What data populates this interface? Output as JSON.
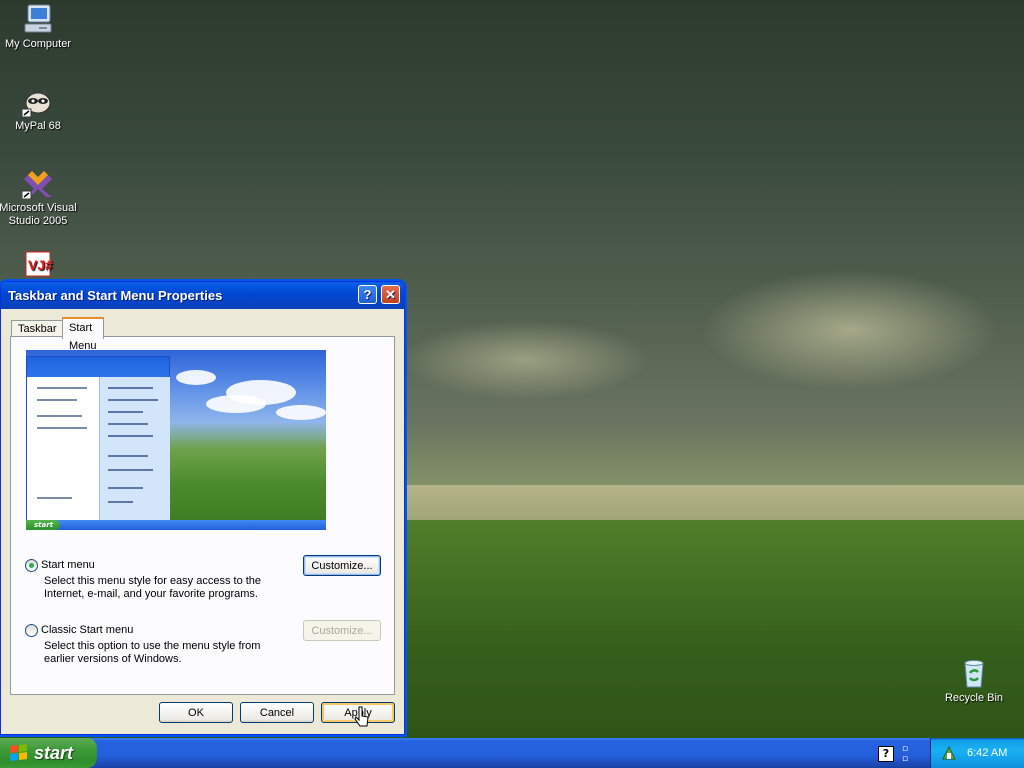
{
  "desktop": {
    "icons": [
      {
        "label": "My Computer",
        "icon": "my-computer-icon"
      },
      {
        "label": "MyPal 68",
        "icon": "mypal-icon"
      },
      {
        "label": "Microsoft Visual Studio 2005",
        "icon": "visual-studio-icon"
      },
      {
        "label": "",
        "icon": "vjsharp-icon"
      },
      {
        "label": "Recycle Bin",
        "icon": "recycle-bin-icon"
      }
    ]
  },
  "dialog": {
    "title": "Taskbar and Start Menu Properties",
    "help_button": "?",
    "close_button": "✕",
    "tabs": [
      {
        "label": "Taskbar",
        "selected": false
      },
      {
        "label": "Start Menu",
        "selected": true
      }
    ],
    "options": [
      {
        "label": "Start menu",
        "selected": true,
        "description": "Select this menu style for easy access to the Internet, e-mail, and your favorite programs.",
        "button": "Customize...",
        "button_enabled": true
      },
      {
        "label": "Classic Start menu",
        "selected": false,
        "description": "Select this option to use the menu style from earlier versions of Windows.",
        "button": "Customize...",
        "button_enabled": false
      }
    ],
    "buttons": {
      "ok": "OK",
      "cancel": "Cancel",
      "apply": "Apply"
    }
  },
  "taskbar": {
    "start_label": "start",
    "clock": "6:42 AM"
  },
  "colors": {
    "titlebar": "#0047d2",
    "start_button": "#3c9a37",
    "taskbar": "#245edb",
    "tray": "#18b1f1",
    "dialog_bg": "#ece9d8"
  }
}
